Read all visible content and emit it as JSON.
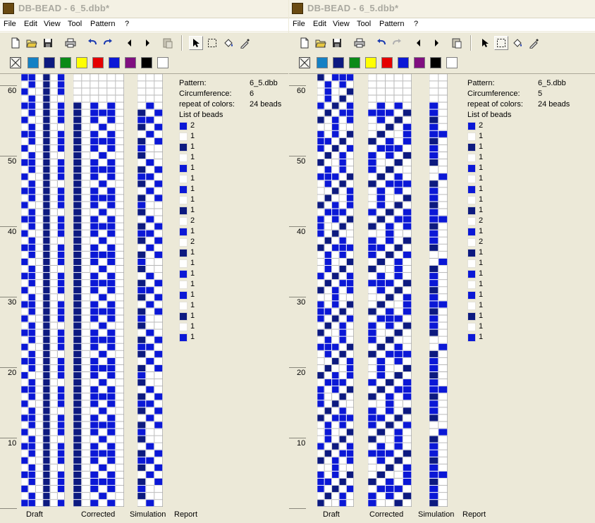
{
  "menus": [
    "File",
    "Edit",
    "View",
    "Tool",
    "Pattern",
    "?"
  ],
  "toolbar_icons": [
    "new-icon",
    "open-icon",
    "save-icon",
    "print-icon",
    "undo-icon",
    "redo-icon",
    "arrow-left-icon",
    "arrow-right-icon",
    "paste-icon",
    "pointer-icon",
    "select-rect-icon",
    "fill-icon",
    "eyedropper-icon"
  ],
  "palette_colors": [
    "#1581c4",
    "#0d1a80",
    "#0a8a17",
    "#ffff00",
    "#e50000",
    "#0b18d6",
    "#800f80",
    "#000000",
    "#ffffff"
  ],
  "colors": {
    "white": "#ffffff",
    "blue": "#0b18d6",
    "navy": "#0d1a80"
  },
  "windows": [
    {
      "title": "DB-BEAD - 6_5.dbb*",
      "ruler_labels": [
        "60",
        "50",
        "40",
        "30",
        "20",
        "10"
      ],
      "column_labels": {
        "draft": "Draft",
        "corrected": "Corrected",
        "simulation": "Simulation",
        "report": "Report"
      },
      "report": {
        "rows": [
          {
            "label": "Pattern:",
            "value": "6_5.dbb"
          },
          {
            "label": "Circumference:",
            "value": "6"
          },
          {
            "label": "repeat of colors:",
            "value": "24 beads"
          }
        ],
        "list_title": "List of beads",
        "beads": [
          {
            "color": "blue",
            "count": "2"
          },
          {
            "color": "white",
            "count": "1"
          },
          {
            "color": "navy",
            "count": "1"
          },
          {
            "color": "white",
            "count": "1"
          },
          {
            "color": "blue",
            "count": "1"
          },
          {
            "color": "white",
            "count": "1"
          },
          {
            "color": "blue",
            "count": "1"
          },
          {
            "color": "white",
            "count": "1"
          },
          {
            "color": "navy",
            "count": "1"
          },
          {
            "color": "white",
            "count": "2"
          },
          {
            "color": "blue",
            "count": "1"
          },
          {
            "color": "white",
            "count": "2"
          },
          {
            "color": "navy",
            "count": "1"
          },
          {
            "color": "white",
            "count": "1"
          },
          {
            "color": "blue",
            "count": "1"
          },
          {
            "color": "white",
            "count": "1"
          },
          {
            "color": "blue",
            "count": "1"
          },
          {
            "color": "white",
            "count": "1"
          },
          {
            "color": "navy",
            "count": "1"
          },
          {
            "color": "white",
            "count": "1"
          },
          {
            "color": "blue",
            "count": "1"
          }
        ]
      }
    },
    {
      "title": "DB-BEAD - 6_5.dbb*",
      "ruler_labels": [
        "60",
        "50",
        "40",
        "30",
        "20",
        "10"
      ],
      "column_labels": {
        "draft": "Draft",
        "corrected": "Corrected",
        "simulation": "Simulation",
        "report": "Report"
      },
      "report": {
        "rows": [
          {
            "label": "Pattern:",
            "value": "6_5.dbb"
          },
          {
            "label": "Circumference:",
            "value": "5"
          },
          {
            "label": "repeat of colors:",
            "value": "24 beads"
          }
        ],
        "list_title": "List of beads",
        "beads": [
          {
            "color": "blue",
            "count": "2"
          },
          {
            "color": "white",
            "count": "1"
          },
          {
            "color": "navy",
            "count": "1"
          },
          {
            "color": "white",
            "count": "1"
          },
          {
            "color": "blue",
            "count": "1"
          },
          {
            "color": "white",
            "count": "1"
          },
          {
            "color": "blue",
            "count": "1"
          },
          {
            "color": "white",
            "count": "1"
          },
          {
            "color": "navy",
            "count": "1"
          },
          {
            "color": "white",
            "count": "2"
          },
          {
            "color": "blue",
            "count": "1"
          },
          {
            "color": "white",
            "count": "2"
          },
          {
            "color": "navy",
            "count": "1"
          },
          {
            "color": "white",
            "count": "1"
          },
          {
            "color": "blue",
            "count": "1"
          },
          {
            "color": "white",
            "count": "1"
          },
          {
            "color": "blue",
            "count": "1"
          },
          {
            "color": "white",
            "count": "1"
          },
          {
            "color": "navy",
            "count": "1"
          },
          {
            "color": "white",
            "count": "1"
          },
          {
            "color": "blue",
            "count": "1"
          }
        ]
      }
    }
  ]
}
